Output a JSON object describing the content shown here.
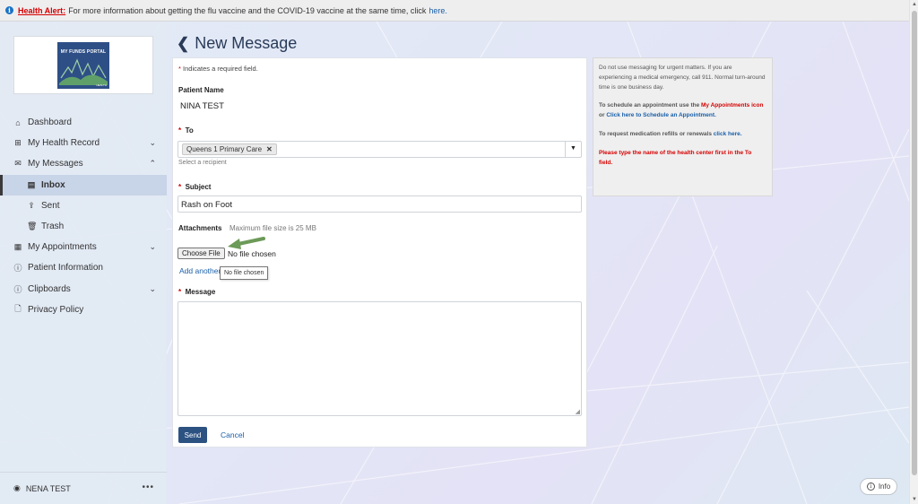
{
  "alert": {
    "title": "Health Alert:",
    "text": "For more information about getting the flu vaccine and the COVID-19 vaccine at the same time, click",
    "link": "here."
  },
  "logo": {
    "title": "MY FUNDS PORTAL",
    "sub": "HEALTH"
  },
  "sidebar": {
    "items": [
      {
        "label": "Dashboard",
        "icon": "home-icon"
      },
      {
        "label": "My Health Record",
        "icon": "health-record-icon"
      },
      {
        "label": "My Messages",
        "icon": "envelope-icon"
      },
      {
        "label": "Inbox",
        "icon": "inbox-icon"
      },
      {
        "label": "Sent",
        "icon": "sent-icon"
      },
      {
        "label": "Trash",
        "icon": "trash-icon"
      },
      {
        "label": "My Appointments",
        "icon": "calendar-icon"
      },
      {
        "label": "Patient Information",
        "icon": "info-circle-icon"
      },
      {
        "label": "Clipboards",
        "icon": "clipboard-icon"
      },
      {
        "label": "Privacy Policy",
        "icon": "document-icon"
      }
    ],
    "user": "NENA TEST"
  },
  "page": {
    "title": "New Message"
  },
  "form": {
    "required_note": "Indicates a required field.",
    "patient_label": "Patient Name",
    "patient_value": "NINA TEST",
    "to_label": "To",
    "to_chip": "Queens 1 Primary Care",
    "to_hint": "Select a recipient",
    "subject_label": "Subject",
    "subject_value": "Rash on Foot",
    "attachments_label": "Attachments",
    "attachments_hint": "Maximum file size is 25 MB",
    "choose_file": "Choose File",
    "file_status": "No file chosen",
    "tooltip": "No file chosen",
    "add_another": "Add another",
    "message_label": "Message",
    "message_value": "",
    "send": "Send",
    "cancel": "Cancel"
  },
  "info": {
    "p1": "Do not use messaging for urgent matters. If you are experiencing a medical emergency, call 911. Normal turn-around time is one business day.",
    "p2_a": "To schedule an appointment use the",
    "p2_link1": "My Appointments icon",
    "p2_b": "or",
    "p2_link2": "Click here to Schedule an Appointment.",
    "p3_a": "To request medication refills or renewals",
    "p3_link": "click here.",
    "p4": "Please type the name of the health center first in the To field."
  },
  "info_button": "Info",
  "colors": {
    "accent": "#2c5282",
    "alert_red": "#d60000",
    "link_blue": "#1a5fa8"
  }
}
